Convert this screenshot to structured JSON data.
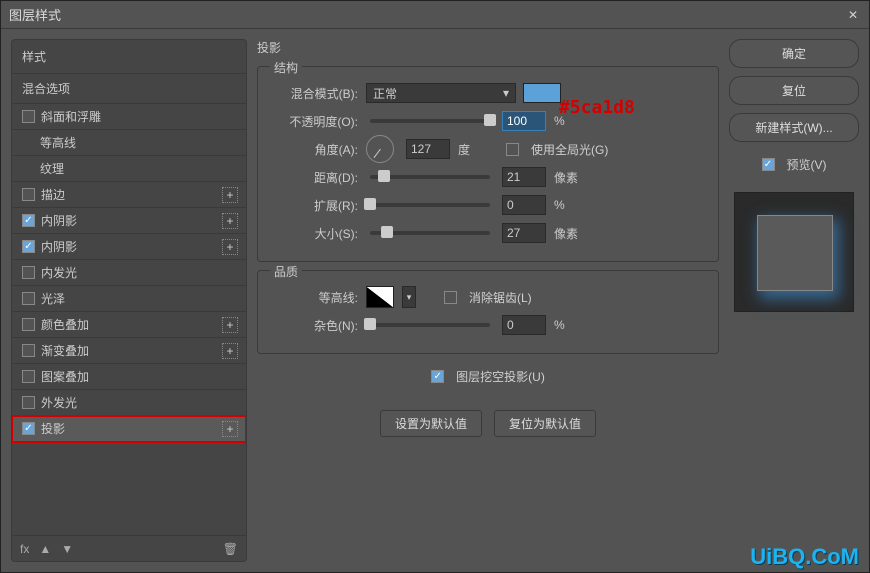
{
  "window": {
    "title": "图层样式",
    "close": "✕"
  },
  "sidebar": {
    "styles_header": "样式",
    "blend_header": "混合选项",
    "items": [
      {
        "label": "斜面和浮雕",
        "checked": false,
        "plus": false,
        "sub": false
      },
      {
        "label": "等高线",
        "checked": false,
        "plus": false,
        "sub": true
      },
      {
        "label": "纹理",
        "checked": false,
        "plus": false,
        "sub": true
      },
      {
        "label": "描边",
        "checked": false,
        "plus": true,
        "sub": false
      },
      {
        "label": "内阴影",
        "checked": true,
        "plus": true,
        "sub": false
      },
      {
        "label": "内阴影",
        "checked": true,
        "plus": true,
        "sub": false
      },
      {
        "label": "内发光",
        "checked": false,
        "plus": false,
        "sub": false
      },
      {
        "label": "光泽",
        "checked": false,
        "plus": false,
        "sub": false
      },
      {
        "label": "颜色叠加",
        "checked": false,
        "plus": true,
        "sub": false
      },
      {
        "label": "渐变叠加",
        "checked": false,
        "plus": true,
        "sub": false
      },
      {
        "label": "图案叠加",
        "checked": false,
        "plus": false,
        "sub": false
      },
      {
        "label": "外发光",
        "checked": false,
        "plus": false,
        "sub": false
      },
      {
        "label": "投影",
        "checked": true,
        "plus": true,
        "sub": false,
        "selected": true,
        "highlight": true
      }
    ],
    "footer": {
      "fx": "fx",
      "trash": "🗑"
    }
  },
  "panel": {
    "title": "投影",
    "structure": {
      "legend": "结构",
      "blend_label": "混合模式(B):",
      "blend_value": "正常",
      "color": "#5ca1d8",
      "opacity_label": "不透明度(O):",
      "opacity_value": "100",
      "opacity_unit": "%",
      "angle_label": "角度(A):",
      "angle_value": "127",
      "angle_unit": "度",
      "global_label": "使用全局光(G)",
      "distance_label": "距离(D):",
      "distance_value": "21",
      "distance_unit": "像素",
      "spread_label": "扩展(R):",
      "spread_value": "0",
      "spread_unit": "%",
      "size_label": "大小(S):",
      "size_value": "27",
      "size_unit": "像素"
    },
    "quality": {
      "legend": "品质",
      "contour_label": "等高线:",
      "antialias_label": "消除锯齿(L)",
      "noise_label": "杂色(N):",
      "noise_value": "0",
      "noise_unit": "%"
    },
    "knockout_label": "图层挖空投影(U)",
    "default_btn": "设置为默认值",
    "reset_btn": "复位为默认值"
  },
  "buttons": {
    "ok": "确定",
    "cancel": "复位",
    "newstyle": "新建样式(W)...",
    "preview": "预览(V)"
  },
  "annotation": "#5ca1d8",
  "watermark": "UiBQ.CoM"
}
